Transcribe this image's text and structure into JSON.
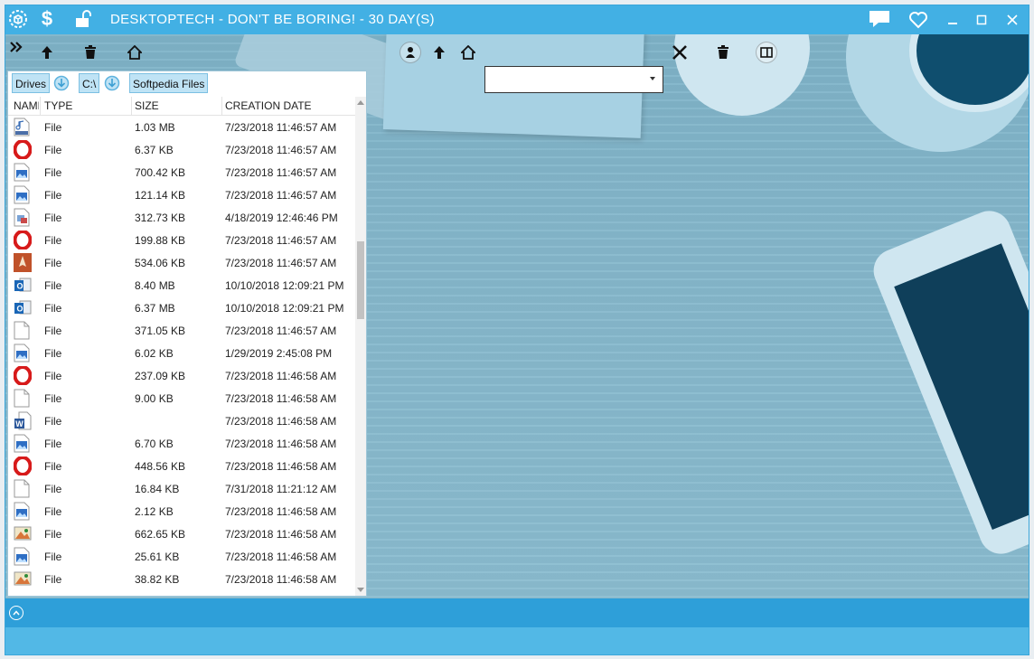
{
  "window": {
    "title": "DESKTOPTECH - DON'T BE BORING! - 30 DAY(S)",
    "accent_color": "#42b0e4",
    "title_icons": [
      "gear-cube-icon",
      "dollar-icon",
      "unlock-icon"
    ],
    "window_controls": [
      "chat-icon",
      "heart-icon",
      "minimize-icon",
      "maximize-icon",
      "close-icon"
    ]
  },
  "left_toolbar": {
    "icons": [
      "expand-chevrons-icon",
      "up-arrow-icon",
      "trash-icon",
      "home-icon"
    ]
  },
  "right_toolbar": {
    "icons": [
      "user-icon",
      "up-arrow-icon",
      "home-icon",
      "close-icon",
      "trash-icon",
      "columns-icon"
    ],
    "path_value": ""
  },
  "breadcrumbs": [
    {
      "label": "Drives"
    },
    {
      "label": "C:\\"
    },
    {
      "label": "Softpedia Files"
    }
  ],
  "columns": {
    "name": "NAME",
    "type": "TYPE",
    "size": "SIZE",
    "created": "CREATION DATE"
  },
  "files": [
    {
      "icon": "mp3-file-icon",
      "type": "File",
      "size": "1.03 MB",
      "created": "7/23/2018 11:46:57 AM"
    },
    {
      "icon": "opera-icon",
      "type": "File",
      "size": "6.37 KB",
      "created": "7/23/2018 11:46:57 AM"
    },
    {
      "icon": "image-file-icon",
      "type": "File",
      "size": "700.42 KB",
      "created": "7/23/2018 11:46:57 AM"
    },
    {
      "icon": "image-file-icon",
      "type": "File",
      "size": "121.14 KB",
      "created": "7/23/2018 11:46:57 AM"
    },
    {
      "icon": "document-image-icon",
      "type": "File",
      "size": "312.73 KB",
      "created": "4/18/2019 12:46:46 PM"
    },
    {
      "icon": "opera-icon",
      "type": "File",
      "size": "199.88 KB",
      "created": "7/23/2018 11:46:57 AM"
    },
    {
      "icon": "pen-tool-icon",
      "type": "File",
      "size": "534.06 KB",
      "created": "7/23/2018 11:46:57 AM"
    },
    {
      "icon": "outlook-icon",
      "type": "File",
      "size": "8.40 MB",
      "created": "10/10/2018 12:09:21 PM"
    },
    {
      "icon": "outlook-icon",
      "type": "File",
      "size": "6.37 MB",
      "created": "10/10/2018 12:09:21 PM"
    },
    {
      "icon": "blank-file-icon",
      "type": "File",
      "size": "371.05 KB",
      "created": "7/23/2018 11:46:57 AM"
    },
    {
      "icon": "image-file-icon",
      "type": "File",
      "size": "6.02 KB",
      "created": "1/29/2019 2:45:08 PM"
    },
    {
      "icon": "opera-icon",
      "type": "File",
      "size": "237.09 KB",
      "created": "7/23/2018 11:46:58 AM"
    },
    {
      "icon": "blank-file-icon",
      "type": "File",
      "size": "9.00 KB",
      "created": "7/23/2018 11:46:58 AM"
    },
    {
      "icon": "word-icon",
      "type": "File",
      "size": "",
      "created": "7/23/2018 11:46:58 AM"
    },
    {
      "icon": "image-file-icon",
      "type": "File",
      "size": "6.70 KB",
      "created": "7/23/2018 11:46:58 AM"
    },
    {
      "icon": "opera-icon",
      "type": "File",
      "size": "448.56 KB",
      "created": "7/23/2018 11:46:58 AM"
    },
    {
      "icon": "blank-file-icon",
      "type": "File",
      "size": "16.84 KB",
      "created": "7/31/2018 11:21:12 AM"
    },
    {
      "icon": "image-file-icon",
      "type": "File",
      "size": "2.12 KB",
      "created": "7/23/2018 11:46:58 AM"
    },
    {
      "icon": "paint-image-icon",
      "type": "File",
      "size": "662.65 KB",
      "created": "7/23/2018 11:46:58 AM"
    },
    {
      "icon": "image-file-icon",
      "type": "File",
      "size": "25.61 KB",
      "created": "7/23/2018 11:46:58 AM"
    },
    {
      "icon": "paint-image-icon",
      "type": "File",
      "size": "38.82 KB",
      "created": "7/23/2018 11:46:58 AM"
    }
  ]
}
